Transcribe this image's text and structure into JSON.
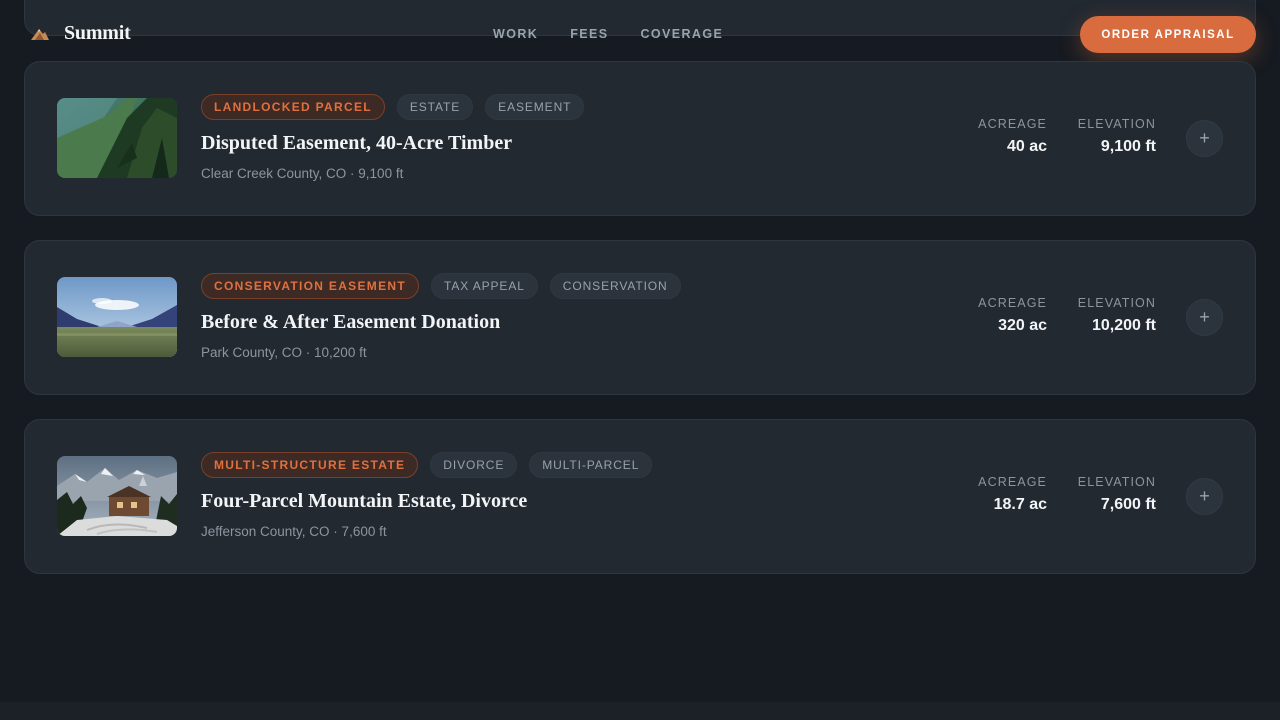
{
  "brand": {
    "name": "Summit",
    "logo": "mountain-logo-icon"
  },
  "nav": {
    "items": [
      "WORK",
      "FEES",
      "COVERAGE"
    ]
  },
  "cta": {
    "label": "ORDER APPRAISAL"
  },
  "stats_labels": {
    "acreage": "ACREAGE",
    "elevation": "ELEVATION"
  },
  "colors": {
    "accent": "#d96c3f",
    "background": "#161b21",
    "card": "#222931"
  },
  "cards": [
    {
      "primary_tag": "LANDLOCKED PARCEL",
      "tags": [
        "ESTATE",
        "EASEMENT"
      ],
      "title": "Disputed Easement, 40-Acre Timber",
      "subtitle": "Clear Creek County, CO · 9,100 ft",
      "acreage": "40 ac",
      "elevation": "9,100 ft",
      "image": "forest-mountainside-photo"
    },
    {
      "primary_tag": "CONSERVATION EASEMENT",
      "tags": [
        "TAX APPEAL",
        "CONSERVATION"
      ],
      "title": "Before & After Easement Donation",
      "subtitle": "Park County, CO · 10,200 ft",
      "acreage": "320 ac",
      "elevation": "10,200 ft",
      "image": "mountain-valley-photo"
    },
    {
      "primary_tag": "MULTI-STRUCTURE ESTATE",
      "tags": [
        "DIVORCE",
        "MULTI-PARCEL"
      ],
      "title": "Four-Parcel Mountain Estate, Divorce",
      "subtitle": "Jefferson County, CO · 7,600 ft",
      "acreage": "18.7 ac",
      "elevation": "7,600 ft",
      "image": "mountain-estate-photo"
    }
  ]
}
